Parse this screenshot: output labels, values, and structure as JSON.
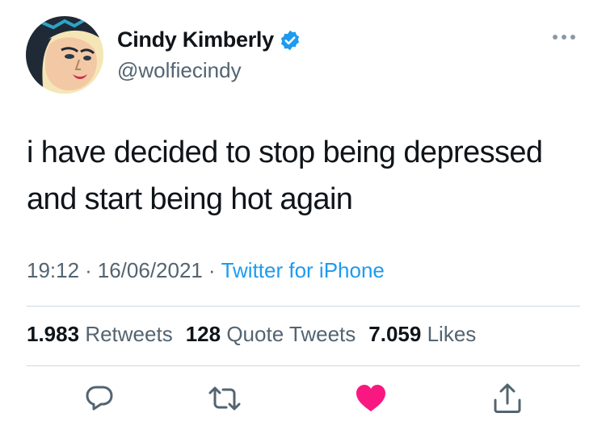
{
  "tweet": {
    "display_name": "Cindy Kimberly",
    "handle": "@wolfiecindy",
    "verified": true,
    "text_line1": "i have decided to stop being depressed",
    "text_line2": "and start being hot again",
    "time": "19:12",
    "date": "16/06/2021",
    "source": "Twitter for iPhone",
    "separator": "·"
  },
  "stats": {
    "retweets_count": "1.983",
    "retweets_label": "Retweets",
    "quotes_count": "128",
    "quotes_label": "Quote Tweets",
    "likes_count": "7.059",
    "likes_label": "Likes"
  },
  "actions": [
    "reply-icon",
    "retweet-icon",
    "like-icon",
    "share-icon"
  ],
  "colors": {
    "text": "#0f1419",
    "secondary": "#536471",
    "link": "#1d9bf0",
    "verified": "#1d9bf0",
    "like": "#f91880",
    "divider": "#cfd9de"
  }
}
